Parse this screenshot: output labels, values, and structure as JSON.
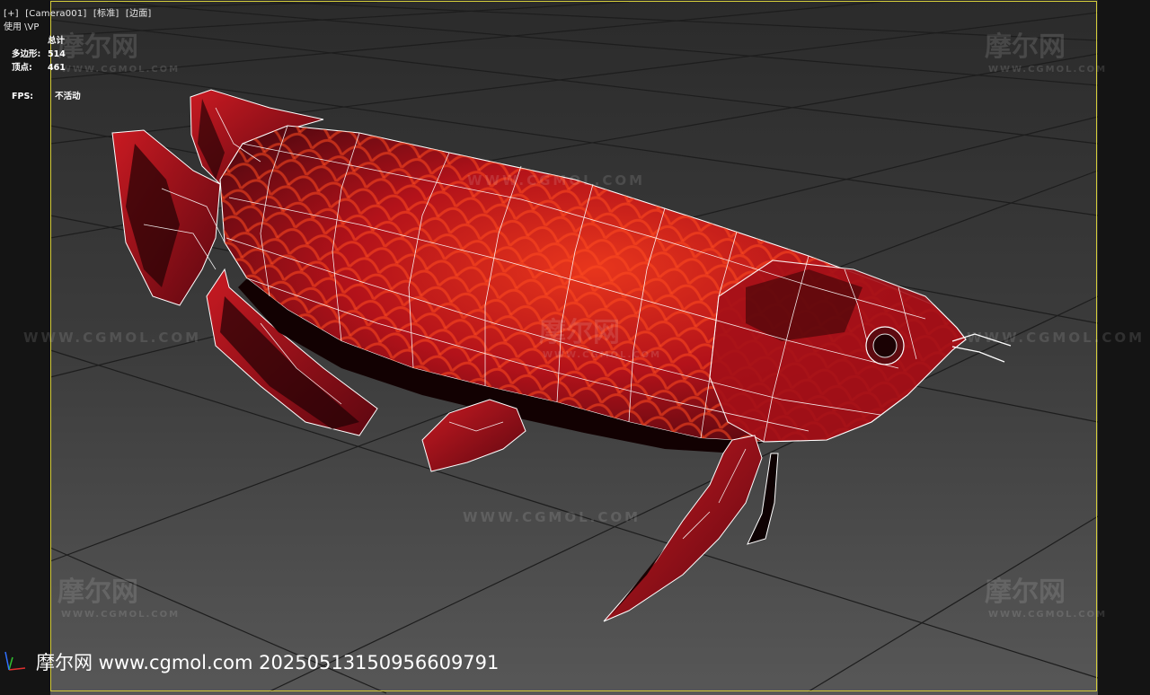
{
  "viewport": {
    "menu": {
      "plus": "[+]",
      "camera": "[Camera001]",
      "shading": "[标准]",
      "display": "[边面]"
    },
    "menu_line2": "使用 \\VP",
    "stats": {
      "header": "总计",
      "polygons_label": "多边形:",
      "polygons_value": "514",
      "vertices_label": "顶点:",
      "vertices_value": "461"
    },
    "fps": {
      "label": "FPS:",
      "value": "不活动"
    }
  },
  "watermarks": {
    "cn": "摩尔网",
    "en": "WWW.CGMOL.COM",
    "big": "WWW.CGMOL.COM"
  },
  "footer": {
    "text": "摩尔网 www.cgmol.com 20250513150956609791"
  },
  "colors": {
    "frame": "#d4cc3a",
    "fish_body": "#b0141a",
    "grid": "#1c1c1c",
    "floor": "#4a4a4a"
  },
  "icons": [
    "axis-gizmo-icon"
  ]
}
